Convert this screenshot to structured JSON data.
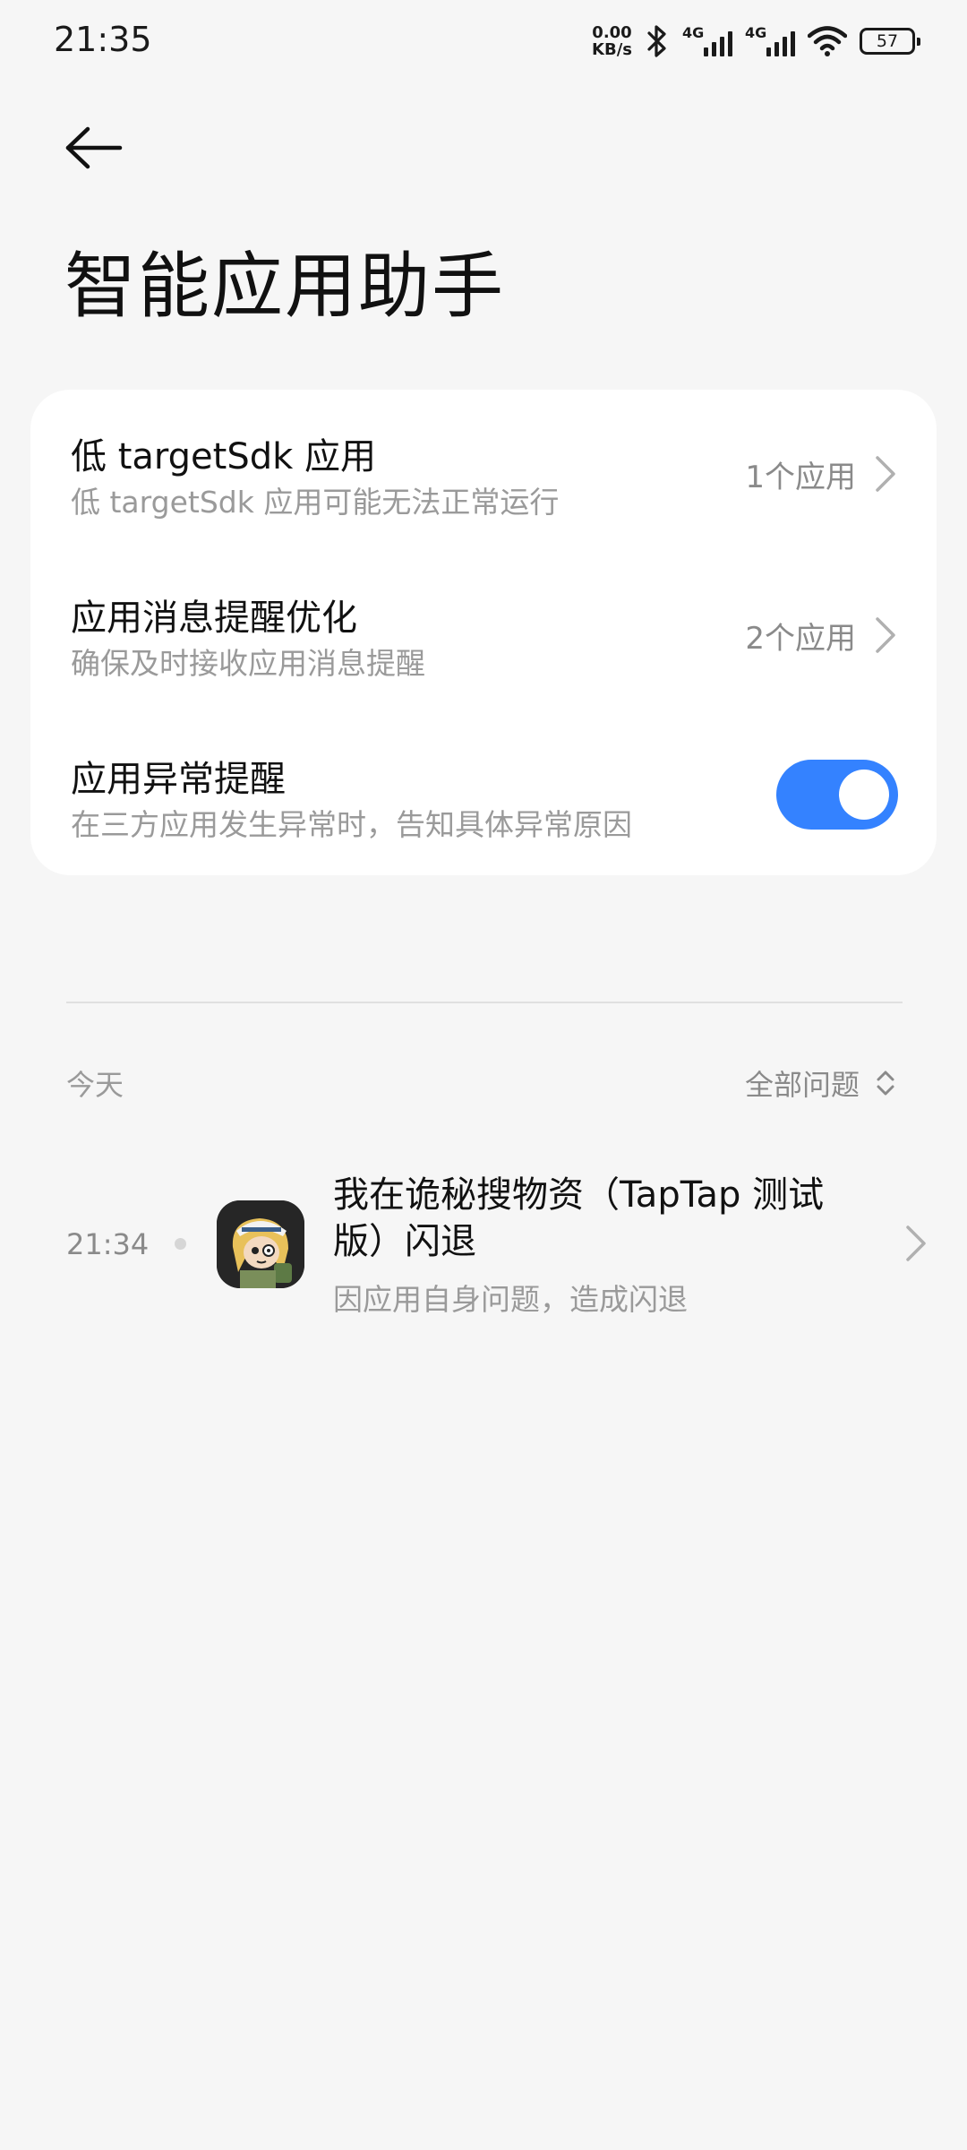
{
  "status_bar": {
    "time": "21:35",
    "net_speed_value": "0.00",
    "net_speed_unit": "KB/s",
    "sim1_label": "4G",
    "sim2_label": "4G",
    "battery": "57",
    "icons": [
      "bluetooth-icon",
      "signal-icon",
      "signal-icon",
      "wifi-icon",
      "battery-icon"
    ]
  },
  "header": {
    "title": "智能应用助手"
  },
  "settings": {
    "low_target_sdk": {
      "title": "低 targetSdk 应用",
      "subtitle": "低 targetSdk 应用可能无法正常运行",
      "value": "1个应用"
    },
    "message_reminder": {
      "title": "应用消息提醒优化",
      "subtitle": "确保及时接收应用消息提醒",
      "value": "2个应用"
    },
    "anomaly_alert": {
      "title": "应用异常提醒",
      "subtitle": "在三方应用发生异常时，告知具体异常原因",
      "enabled": true
    }
  },
  "log": {
    "section_label": "今天",
    "filter_label": "全部问题",
    "entries": [
      {
        "time": "21:34",
        "title": "我在诡秘搜物资（TapTap 测试版）闪退",
        "subtitle": "因应用自身问题，造成闪退"
      }
    ]
  },
  "colors": {
    "background": "#f6f6f6",
    "card": "#ffffff",
    "toggle_on": "#3482ff"
  }
}
